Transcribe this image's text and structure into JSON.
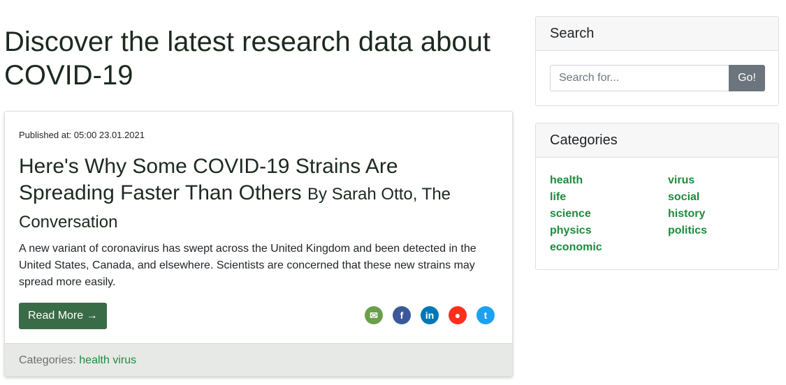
{
  "page": {
    "title": "Discover the latest research data about COVID-19"
  },
  "post": {
    "published": "Published at: 05:00 23.01.2021",
    "title": "Here's Why Some COVID-19 Strains Are Spreading Faster Than Others",
    "byline": "By Sarah Otto, The Conversation",
    "excerpt": "A new variant of coronavirus has swept across the United Kingdom and been detected in the United States, Canada, and elsewhere. Scientists are concerned that these new strains may spread more easily.",
    "read_more": "Read More →",
    "share": [
      {
        "name": "email",
        "glyph": "✉",
        "color": "#6aa04a"
      },
      {
        "name": "facebook",
        "glyph": "f",
        "color": "#3b5998"
      },
      {
        "name": "linkedin",
        "glyph": "in",
        "color": "#0077b5"
      },
      {
        "name": "reddit",
        "glyph": "●",
        "color": "#ff2e1f"
      },
      {
        "name": "twitter",
        "glyph": "t",
        "color": "#1da1f2"
      }
    ],
    "footer": {
      "label": "Categories:",
      "categories": [
        "health",
        "virus"
      ]
    }
  },
  "search": {
    "title": "Search",
    "placeholder": "Search for...",
    "button": "Go!"
  },
  "categories": {
    "title": "Categories",
    "col1": [
      "health",
      "life",
      "science",
      "physics",
      "economic"
    ],
    "col2": [
      "virus",
      "social",
      "history",
      "politics"
    ]
  },
  "colors": {
    "accent": "#3a6b47",
    "link": "#1e8a3e"
  }
}
